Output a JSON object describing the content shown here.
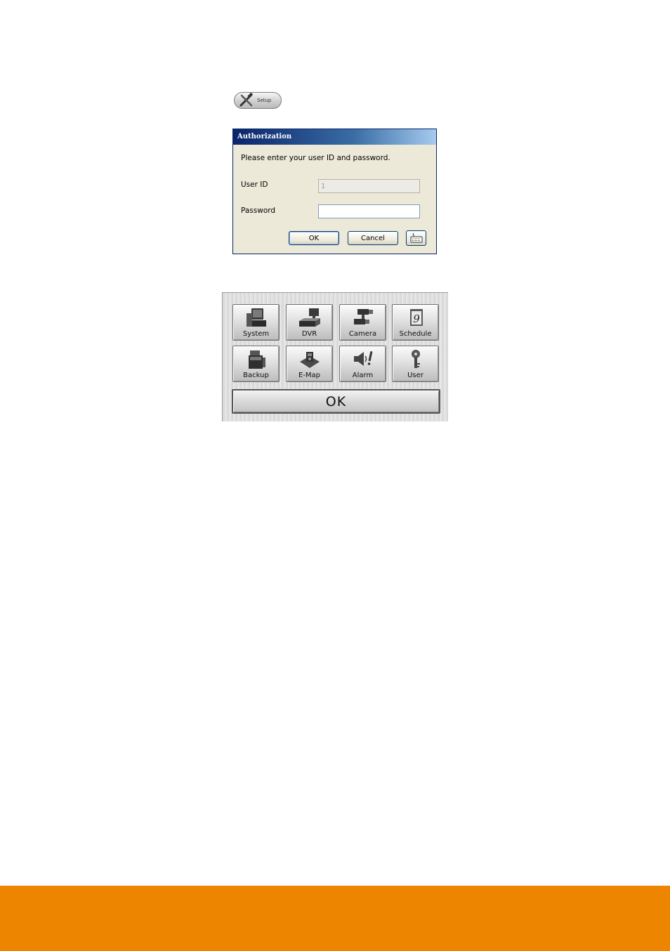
{
  "setup_button": {
    "label": "Setup",
    "icon": "tools-icon"
  },
  "auth_dialog": {
    "title": "Authorization",
    "prompt": "Please enter your user ID and password.",
    "user_id_label": "User ID",
    "user_id_value": "1",
    "password_label": "Password",
    "password_value": "",
    "ok_label": "OK",
    "cancel_label": "Cancel",
    "keyboard_icon": "keyboard-icon"
  },
  "setup_menu": {
    "tiles": [
      {
        "label": "System",
        "icon": "computer-icon"
      },
      {
        "label": "DVR",
        "icon": "dvr-icon"
      },
      {
        "label": "Camera",
        "icon": "camera-icon"
      },
      {
        "label": "Schedule",
        "icon": "calendar-icon"
      },
      {
        "label": "Backup",
        "icon": "backup-icon"
      },
      {
        "label": "E-Map",
        "icon": "map-icon"
      },
      {
        "label": "Alarm",
        "icon": "alarm-icon"
      },
      {
        "label": "User",
        "icon": "user-key-icon"
      }
    ],
    "ok_label": "OK"
  },
  "colors": {
    "footer_bar": "#ee8500",
    "dialog_title_bar": "#0a246a",
    "dialog_body": "#ece9d8"
  }
}
